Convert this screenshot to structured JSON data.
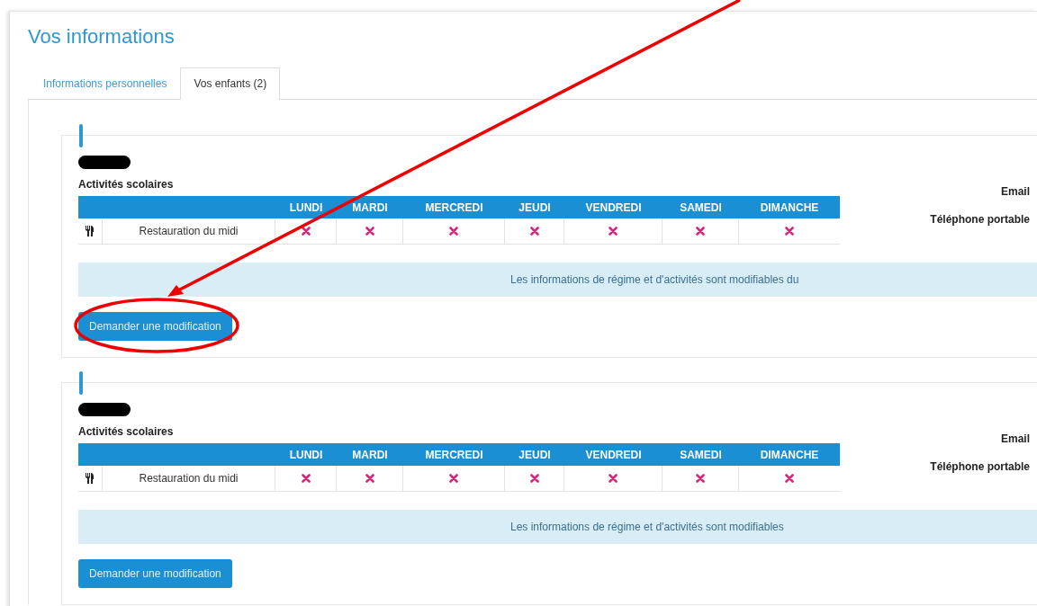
{
  "title": "Vos informations",
  "tabs": [
    {
      "label": "Informations personnelles",
      "selected": false
    },
    {
      "label": "Vos enfants (2)",
      "selected": true
    }
  ],
  "children": [
    {
      "section_title": "Activités scolaires",
      "columns": [
        "LUNDI",
        "MARDI",
        "MERCREDI",
        "JEUDI",
        "VENDREDI",
        "SAMEDI",
        "DIMANCHE"
      ],
      "rows": [
        {
          "activity": "Restauration du midi",
          "days": [
            false,
            false,
            false,
            false,
            false,
            false,
            false
          ]
        }
      ],
      "contact_labels": [
        "Email",
        "Téléphone portable"
      ],
      "notice": "Les informations de régime et d'activités sont modifiables du",
      "button": "Demander une modification"
    },
    {
      "section_title": "Activités scolaires",
      "columns": [
        "LUNDI",
        "MARDI",
        "MERCREDI",
        "JEUDI",
        "VENDREDI",
        "SAMEDI",
        "DIMANCHE"
      ],
      "rows": [
        {
          "activity": "Restauration du midi",
          "days": [
            false,
            false,
            false,
            false,
            false,
            false,
            false
          ]
        }
      ],
      "contact_labels": [
        "Email",
        "Téléphone portable"
      ],
      "notice": "Les informations de régime et d'activités sont modifiables",
      "button": "Demander une modification"
    }
  ]
}
